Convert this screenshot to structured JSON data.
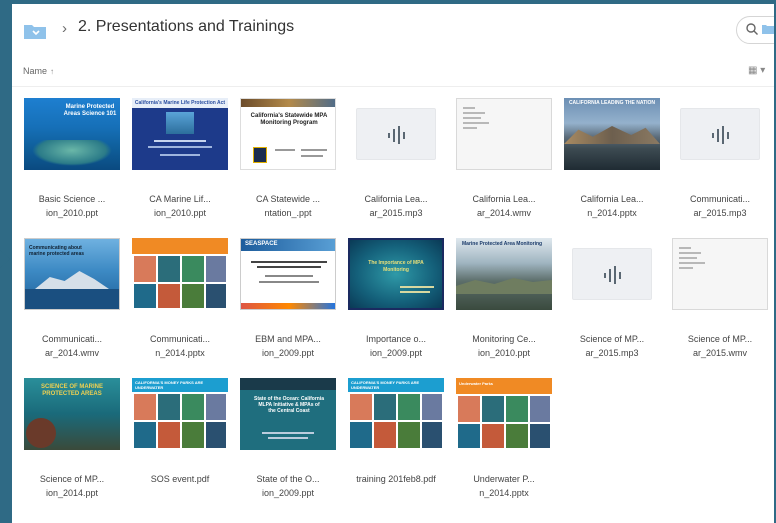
{
  "header": {
    "crumb_separator": "›",
    "title": "2. Presentations and Trainings"
  },
  "sort": {
    "label": "Name",
    "arrow": "↑",
    "view_toggle": "▦ ▾"
  },
  "files": [
    {
      "name1": "Basic Science ...",
      "name2": "ion_2010.ppt",
      "kind": "slide",
      "thumb_title": "Marine Protected Areas Science 101"
    },
    {
      "name1": "CA Marine Lif...",
      "name2": "ion_2010.ppt",
      "kind": "slide",
      "thumb_title": "California's Marine Life Protection Act"
    },
    {
      "name1": "CA Statewide ...",
      "name2": "ntation_.ppt",
      "kind": "slide",
      "thumb_title": "California's Statewide MPA Monitoring Program"
    },
    {
      "name1": "California Lea...",
      "name2": "ar_2015.mp3",
      "kind": "audio"
    },
    {
      "name1": "California Lea...",
      "name2": "ar_2014.wmv",
      "kind": "doc"
    },
    {
      "name1": "California Lea...",
      "name2": "n_2014.pptx",
      "kind": "slide",
      "thumb_title": "CALIFORNIA LEADING THE NATION"
    },
    {
      "name1": "Communicati...",
      "name2": "ar_2015.mp3",
      "kind": "audio"
    },
    {
      "name1": "Communicati...",
      "name2": "ar_2014.wmv",
      "kind": "slide",
      "thumb_title": "Communicating about marine protected areas"
    },
    {
      "name1": "Communicati...",
      "name2": "n_2014.pptx",
      "kind": "slide"
    },
    {
      "name1": "EBM and MPA...",
      "name2": "ion_2009.ppt",
      "kind": "slide",
      "thumb_title": "SEASPACE"
    },
    {
      "name1": "Importance o...",
      "name2": "ion_2009.ppt",
      "kind": "slide",
      "thumb_title": "The Importance of MPA Monitoring"
    },
    {
      "name1": "Monitoring Ce...",
      "name2": "ion_2010.ppt",
      "kind": "slide",
      "thumb_title": "Marine Protected Area Monitoring"
    },
    {
      "name1": "Science of MP...",
      "name2": "ar_2015.mp3",
      "kind": "audio"
    },
    {
      "name1": "Science of MP...",
      "name2": "ar_2015.wmv",
      "kind": "doc"
    },
    {
      "name1": "Science of MP...",
      "name2": "ion_2014.ppt",
      "kind": "slide",
      "thumb_title": "SCIENCE OF MARINE PROTECTED AREAS"
    },
    {
      "name1": "SOS event.pdf",
      "name2": "",
      "kind": "slide",
      "thumb_title": "CALIFORNIA'S MONEY PARKS ARE UNDERWATER"
    },
    {
      "name1": "State of the O...",
      "name2": "ion_2009.ppt",
      "kind": "slide",
      "thumb_title": "State of the Ocean: California MLPA Initiative & MPAs of the Central Coast"
    },
    {
      "name1": "training 201feb8.pdf",
      "name2": "",
      "kind": "slide",
      "thumb_title": "CALIFORNIA'S MONEY PARKS ARE UNDERWATER"
    },
    {
      "name1": "Underwater P...",
      "name2": "n_2014.pptx",
      "kind": "slide",
      "thumb_title": "Underwater Parks"
    }
  ],
  "colors": {
    "background": "#2f6a85",
    "folder": "#8fc2ea",
    "accent": "#1a73e8"
  }
}
